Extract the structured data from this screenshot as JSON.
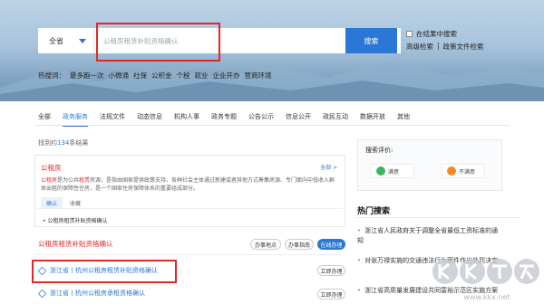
{
  "search": {
    "scope": "全省",
    "query": "公租房租赁补贴资格确认",
    "button": "搜索",
    "in_results": "在结果中搜索",
    "advanced": "高级检索",
    "policy": "政策文件检索"
  },
  "hot": {
    "label": "热搜词：",
    "words": [
      "最多跑一次",
      "小微通",
      "社保",
      "公积金",
      "个税",
      "就业",
      "企业开办",
      "营商环境"
    ]
  },
  "tabs": [
    "全部",
    "政务服务",
    "法规文件",
    "动态信息",
    "机构人事",
    "政务专题",
    "公告公示",
    "信息公开",
    "政民互动",
    "数据开放",
    "其他"
  ],
  "active_tab": 1,
  "result_count": {
    "prefix": "找到约",
    "num": "134",
    "suffix": "条结果"
  },
  "result1": {
    "title": "公租房",
    "more": "全部 >",
    "desc_a": "公租房",
    "desc_b": "是为公共",
    "desc_c": "租赁",
    "desc_d": "房源，是指由国家提供政策支持、各种社会主体通过新建或者其他方式筹集房源、专门面向中低收入群体出租的保障性住房，是一个国家住房保障体系的重要组成部分。",
    "chip1": "确认",
    "chip2": "收藏",
    "sub": "公租房租赁补贴资格确认"
  },
  "item2": {
    "title": "公租房租赁补贴资格确认",
    "btn1": "办事地点",
    "btn2": "办事指南",
    "btn3": "在线办理"
  },
  "rows": [
    {
      "text": "浙江省丨杭州公租房租赁补贴资格确认",
      "btn": "立即办理"
    },
    {
      "text": "浙江省丨杭州公租房承租资格确认",
      "btn": "立即办理"
    }
  ],
  "eval": {
    "title": "搜索评价:",
    "good": "满意",
    "bad": "不满意"
  },
  "hot_news": {
    "title": "热门搜索",
    "items": [
      "浙江省人民政府关于调整全省最低工资标准的通知",
      "对张万禄实施的交通违法行为案件作出处罚决定",
      "浙江省高质量发展建设共同富裕示范区实施方案"
    ]
  },
  "colors": {
    "accent": "#2b78d4",
    "highlight": "#e02828"
  }
}
